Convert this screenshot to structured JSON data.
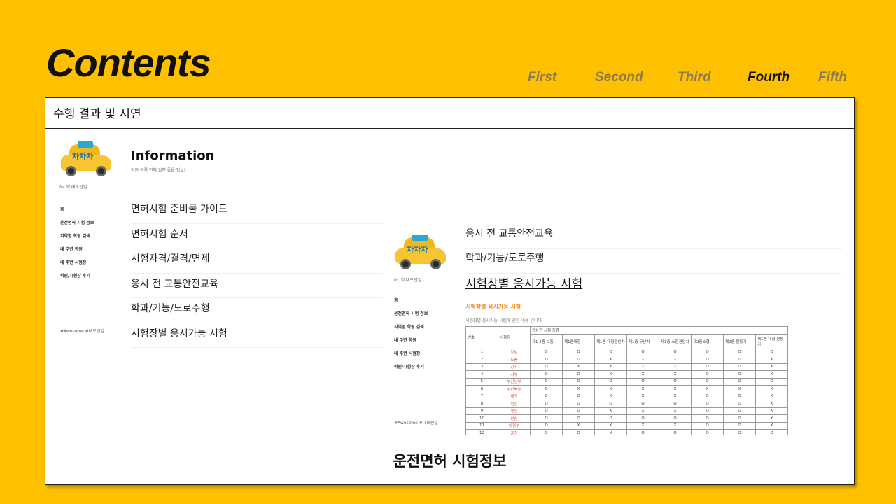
{
  "slide": {
    "title": "Contents",
    "nav": [
      {
        "label": "First",
        "active": false
      },
      {
        "label": "Second",
        "active": false
      },
      {
        "label": "Third",
        "active": false
      },
      {
        "label": "Fourth",
        "active": true
      },
      {
        "label": "Fifth",
        "active": false
      }
    ]
  },
  "frame": {
    "header": "수행 결과 및 시연",
    "caption": "운전면허 시험정보"
  },
  "left_shot": {
    "logo_text": "차차차",
    "logo_sub": "fo, 킥 대로선일",
    "menu": [
      "홈",
      "운전면허 시험 정보",
      "지역별 학원 검색",
      "내 주변 학원",
      "내 주변 시험장",
      "학원/시험장 후기"
    ],
    "footer": "#Awesome #대로선일",
    "info_title": "Information",
    "info_sub": "학원 등록 전에 알면 좋을 정보!",
    "list": [
      "면허시험 준비물 가이드",
      "면허시험 순서",
      "시험자격/결격/면제",
      "응시 전 교통안전교육",
      "학과/기능/도로주행",
      "시험장별 응시가능 시험"
    ]
  },
  "right_shot": {
    "logo_text": "차차차",
    "logo_sub": "fo, 킥 대로선일",
    "menu": [
      "홈",
      "운전면허 시험 정보",
      "지역별 학원 검색",
      "내 주변 학원",
      "내 주변 시험장",
      "학원/시험장 후기"
    ],
    "footer": "#Awesome #대로선일",
    "list": [
      "응시 전 교통안전교육",
      "학과/기능/도로주행"
    ],
    "active_item": "시험장별 응시가능 시험",
    "section_title": "시험장별 응시가능 시험",
    "section_sub": "시험장별 응시가능 시험에 관한 내용 입니다",
    "table": {
      "col_no": "번호",
      "col_place": "시험장",
      "group_header": "가능한 시험 종류",
      "types": [
        "제1·2종 보통",
        "제1종대형",
        "제1종 대형견인차",
        "제1종 구난차",
        "제1종 소형견인차",
        "제2종소형",
        "제2종 원동기",
        "제1종 대형 원동기"
      ],
      "rows": [
        {
          "no": "1",
          "place": "강남",
          "vals": [
            "O",
            "O",
            "O",
            "O",
            "O",
            "O",
            "O",
            "O"
          ]
        },
        {
          "no": "2",
          "place": "도봉",
          "vals": [
            "O",
            "O",
            "X",
            "X",
            "X",
            "O",
            "O",
            "X"
          ]
        },
        {
          "no": "3",
          "place": "강서",
          "vals": [
            "O",
            "X",
            "X",
            "X",
            "X",
            "O",
            "O",
            "X"
          ]
        },
        {
          "no": "4",
          "place": "서부",
          "vals": [
            "O",
            "O",
            "X",
            "X",
            "X",
            "O",
            "O",
            "X"
          ]
        },
        {
          "no": "5",
          "place": "부산남부",
          "vals": [
            "O",
            "O",
            "O",
            "O",
            "O",
            "O",
            "O",
            "O"
          ]
        },
        {
          "no": "6",
          "place": "부산북부",
          "vals": [
            "O",
            "X",
            "X",
            "X",
            "X",
            "X",
            "X",
            "X"
          ]
        },
        {
          "no": "7",
          "place": "대구",
          "vals": [
            "O",
            "O",
            "X",
            "X",
            "X",
            "O",
            "O",
            "X"
          ]
        },
        {
          "no": "8",
          "place": "인천",
          "vals": [
            "O",
            "O",
            "O",
            "O",
            "O",
            "O",
            "O",
            "X"
          ]
        },
        {
          "no": "9",
          "place": "용인",
          "vals": [
            "O",
            "O",
            "X",
            "X",
            "X",
            "O",
            "O",
            "X"
          ]
        },
        {
          "no": "10",
          "place": "안산",
          "vals": [
            "O",
            "O",
            "O",
            "O",
            "O",
            "O",
            "O",
            "X"
          ]
        },
        {
          "no": "11",
          "place": "의정부",
          "vals": [
            "O",
            "X",
            "X",
            "X",
            "X",
            "O",
            "O",
            "X"
          ]
        },
        {
          "no": "12",
          "place": "춘천",
          "vals": [
            "O",
            "O",
            "X",
            "O",
            "O",
            "O",
            "O",
            "O"
          ]
        }
      ]
    }
  }
}
